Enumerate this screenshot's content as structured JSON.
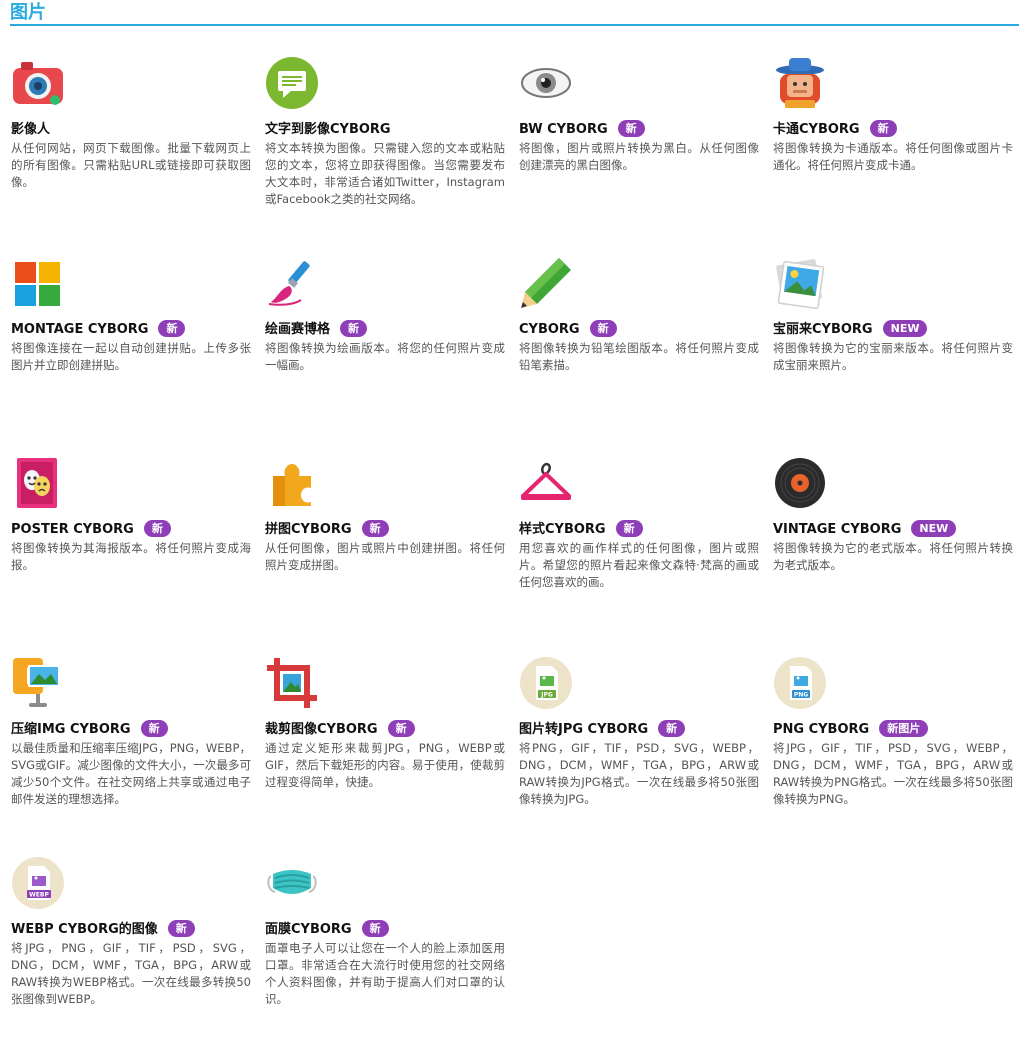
{
  "section": {
    "title": "图片"
  },
  "cards": [
    {
      "title": "影像人",
      "badge": "",
      "icon": "camera-icon",
      "desc": "从任何网站，网页下载图像。批量下载网页上的所有图像。只需粘贴URL或链接即可获取图像。"
    },
    {
      "title": "文字到影像CYBORG",
      "badge": "",
      "icon": "chat-bubble-icon",
      "desc": "将文本转换为图像。只需键入您的文本或粘贴您的文本，您将立即获得图像。当您需要发布大文本时，非常适合诸如Twitter，Instagram或Facebook之类的社交网络。"
    },
    {
      "title": "BW CYBORG",
      "badge": "新",
      "icon": "eye-icon",
      "desc": "将图像，图片或照片转换为黑白。从任何图像创建漂亮的黑白图像。"
    },
    {
      "title": "卡通CYBORG",
      "badge": "新",
      "icon": "cowboy-icon",
      "desc": "将图像转换为卡通版本。将任何图像或图片卡通化。将任何照片变成卡通。"
    },
    {
      "title": "MONTAGE CYBORG",
      "badge": "新",
      "icon": "windows-grid-icon",
      "desc": "将图像连接在一起以自动创建拼贴。上传多张图片并立即创建拼贴。"
    },
    {
      "title": "绘画赛博格",
      "badge": "新",
      "icon": "paintbrush-icon",
      "desc": "将图像转换为绘画版本。将您的任何照片变成一幅画。"
    },
    {
      "title": "CYBORG",
      "badge": "新",
      "icon": "pencil-icon",
      "desc": "将图像转换为铅笔绘图版本。将任何照片变成铅笔素描。"
    },
    {
      "title": "宝丽来CYBORG",
      "badge": "NEW",
      "icon": "polaroid-icon",
      "desc": "将图像转换为它的宝丽来版本。将任何照片变成宝丽来照片。"
    },
    {
      "title": "POSTER CYBORG",
      "badge": "新",
      "icon": "theater-masks-icon",
      "desc": "将图像转换为其海报版本。将任何照片变成海报。"
    },
    {
      "title": "拼图CYBORG",
      "badge": "新",
      "icon": "puzzle-piece-icon",
      "desc": "从任何图像，图片或照片中创建拼图。将任何照片变成拼图。"
    },
    {
      "title": "样式CYBORG",
      "badge": "新",
      "icon": "hanger-icon",
      "desc": "用您喜欢的画作样式的任何图像，图片或照片。希望您的照片看起来像文森特·梵高的画或任何您喜欢的画。"
    },
    {
      "title": "VINTAGE CYBORG",
      "badge": "NEW",
      "icon": "vinyl-record-icon",
      "desc": "将图像转换为它的老式版本。将任何照片转换为老式版本。"
    },
    {
      "title": "压缩IMG CYBORG",
      "badge": "新",
      "icon": "compress-clamp-icon",
      "desc": "以最佳质量和压缩率压缩JPG，PNG，WEBP，SVG或GIF。减少图像的文件大小，一次最多可减少50个文件。在社交网络上共享或通过电子邮件发送的理想选择。"
    },
    {
      "title": "裁剪图像CYBORG",
      "badge": "新",
      "icon": "crop-icon",
      "desc": "通过定义矩形来裁剪JPG，PNG，WEBP或GIF，然后下载矩形的内容。易于使用，使裁剪过程变得简单，快捷。"
    },
    {
      "title": "图片转JPG CYBORG",
      "badge": "新",
      "icon": "jpg-file-icon",
      "desc": "将PNG，GIF，TIF，PSD，SVG，WEBP，DNG，DCM，WMF，TGA，BPG，ARW或RAW转换为JPG格式。一次在线最多将50张图像转换为JPG。"
    },
    {
      "title": "PNG CYBORG",
      "badge": "新图片",
      "icon": "png-file-icon",
      "desc": "将JPG，GIF，TIF，PSD，SVG，WEBP，DNG，DCM，WMF，TGA，BPG，ARW或RAW转换为PNG格式。一次在线最多将50张图像转换为PNG。"
    },
    {
      "title": "WEBP CYBORG的图像",
      "badge": "新",
      "icon": "webp-file-icon",
      "desc": "将JPG，PNG，GIF，TIF，PSD，SVG，DNG，DCM，WMF，TGA，BPG，ARW或RAW转换为WEBP格式。一次在线最多转换50张图像到WEBP。"
    },
    {
      "title": "面膜CYBORG",
      "badge": "新",
      "icon": "face-mask-icon",
      "desc": "面罩电子人可以让您在一个人的脸上添加医用口罩。非常适合在大流行时使用您的社交网络个人资料图像，并有助于提高人们对口罩的认识。"
    }
  ]
}
